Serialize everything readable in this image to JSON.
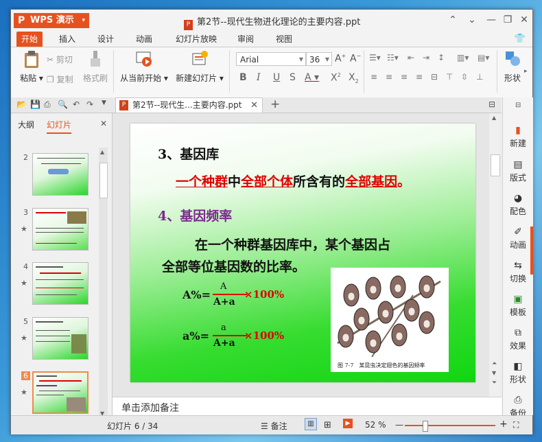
{
  "title_bar": {
    "app_label": "WPS 演示",
    "document_title": "第2节--现代生物进化理论的主要内容.ppt"
  },
  "menu_tabs": [
    "开始",
    "插入",
    "设计",
    "动画",
    "幻灯片放映",
    "审阅",
    "视图"
  ],
  "ribbon": {
    "paste": "粘贴",
    "cut": "剪切",
    "copy": "复制",
    "format_painter": "格式刷",
    "from_current": "从当前开始",
    "new_slide": "新建幻灯片",
    "font_name": "Arial",
    "font_size": "36",
    "shape": "形状"
  },
  "doc_tab": {
    "label": "第2节--现代生...主要内容.ppt"
  },
  "left_panel": {
    "tabs": [
      "大纲",
      "幻灯片"
    ],
    "thumbnails": [
      {
        "number": "2"
      },
      {
        "number": "3"
      },
      {
        "number": "4"
      },
      {
        "number": "5"
      },
      {
        "number": "6"
      }
    ]
  },
  "slide": {
    "heading1": "3、基因库",
    "def_part1": "一个种群",
    "def_part2": "中",
    "def_part3": "全部个体",
    "def_part4": "所含有的",
    "def_part5": "全部基因",
    "def_part6": "。",
    "heading2": "4、基因频率",
    "body_line1": "在一个种群基因库中，某个基因占",
    "body_line2": "全部等位基因数的比率。",
    "formula1_label": "A%=",
    "formula1_num": "A",
    "formula1_den": "A+a",
    "formula1_times": "×100%",
    "formula2_label": "a%=",
    "formula2_num": "a",
    "formula2_den": "A+a",
    "formula2_times": "×100%",
    "figure_caption": "图 7-7　某昆虫决定翅色的基因频率"
  },
  "notes_placeholder": "单击添加备注",
  "right_panel": [
    "新建",
    "版式",
    "配色",
    "动画",
    "切换",
    "模板",
    "效果",
    "形状",
    "备份"
  ],
  "status_bar": {
    "slide_counter": "幻灯片 6 / 34",
    "notes": "备注",
    "zoom": "52 %"
  },
  "colors": {
    "accent": "#e5521f",
    "slide_red": "#e00000",
    "slide_purple": "#7a2a8c"
  }
}
